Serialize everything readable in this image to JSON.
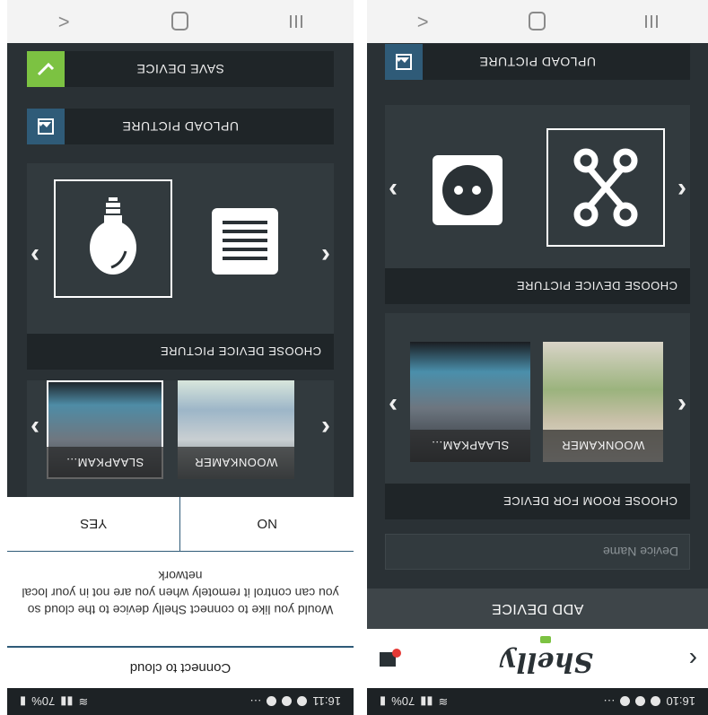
{
  "status": {
    "time_left": "16:11",
    "time_right": "16:10",
    "battery": "70%"
  },
  "navbar": {
    "back": "<",
    "home": "home",
    "recent": "recent"
  },
  "left": {
    "save_device": "SAVE DEVICE",
    "upload_picture": "UPLOAD PICTURE",
    "choose_device_picture": "CHOOSE DEVICE PICTURE",
    "room_labels": [
      "SLAAPKAM...",
      "WOONKAMER"
    ],
    "dialog": {
      "title": "Connect to cloud",
      "message": "Would you like to connect Shelly device to the cloud so you can control it remotely when you are not in your local network",
      "no": "NO",
      "yes": "YES"
    }
  },
  "right": {
    "upload_picture": "UPLOAD PICTURE",
    "choose_device_picture": "CHOOSE DEVICE PICTURE",
    "choose_room": "CHOOSE ROOM FOR DEVICE",
    "room_labels": [
      "WOONKAMER",
      "SLAAPKAM..."
    ],
    "device_name_placeholder": "Device Name",
    "add_device": "ADD DEVICE",
    "brand": "Shelly"
  },
  "icons": {
    "save": "check-icon",
    "upload": "image-icon",
    "bulb": "bulb-icon",
    "roller": "roller-shutter-icon",
    "socket": "socket-icon",
    "relay": "relay-icon",
    "back": "chevron-icon",
    "home": "home-icon",
    "recent": "recent-apps-icon"
  },
  "colors": {
    "accent_green": "#7cc242",
    "upload_blue": "#2f5b78",
    "dark": "#2a3135",
    "bar": "#1f2528"
  }
}
